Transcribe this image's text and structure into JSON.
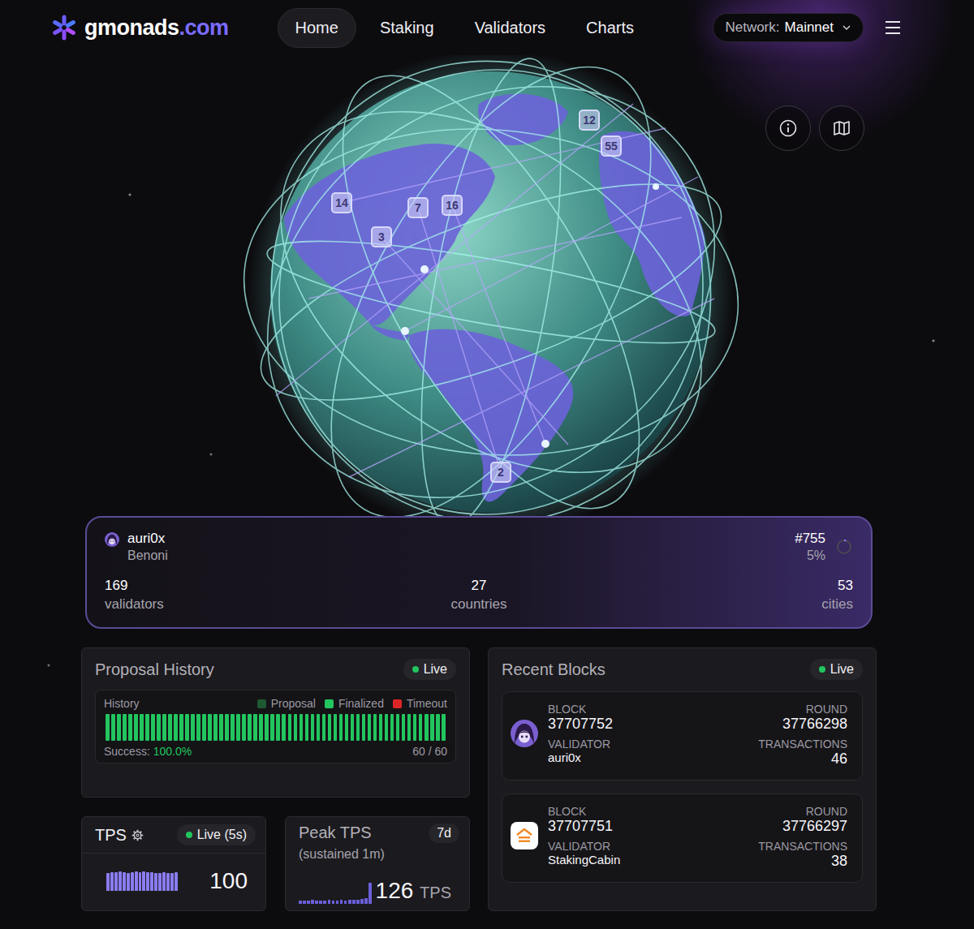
{
  "logo": {
    "name": "gmonads",
    "tld": ".com"
  },
  "nav": [
    {
      "label": "Home",
      "selected": true
    },
    {
      "label": "Staking",
      "selected": false
    },
    {
      "label": "Validators",
      "selected": false
    },
    {
      "label": "Charts",
      "selected": false
    }
  ],
  "network": {
    "label": "Network:",
    "value": "Mainnet"
  },
  "pins": [
    {
      "label": "12"
    },
    {
      "label": "55"
    },
    {
      "label": "14"
    },
    {
      "label": "7"
    },
    {
      "label": "16"
    },
    {
      "label": "3"
    },
    {
      "label": "2"
    }
  ],
  "current": {
    "validator": "auri0x",
    "city": "Benoni",
    "avatar": "anime",
    "rank": "#755",
    "progress": "5%",
    "level": 0.05
  },
  "stats": [
    {
      "value": "169",
      "label": "validators"
    },
    {
      "value": "27",
      "label": "countries"
    },
    {
      "value": "53",
      "label": "cities"
    }
  ],
  "proposal_history": {
    "title": "Proposal History",
    "live": "Live",
    "label": "History",
    "legend": [
      {
        "label": "Proposal",
        "kind": "proposal",
        "color": "#1e5a31"
      },
      {
        "label": "Finalized",
        "kind": "finalized",
        "color": "#22c55e"
      },
      {
        "label": "Timeout",
        "kind": "timeout",
        "color": "#dc2626"
      }
    ],
    "bars": [
      "finalized",
      "finalized",
      "finalized",
      "finalized",
      "finalized",
      "finalized",
      "finalized",
      "finalized",
      "finalized",
      "finalized",
      "finalized",
      "finalized",
      "finalized",
      "finalized",
      "finalized",
      "finalized",
      "finalized",
      "finalized",
      "finalized",
      "finalized",
      "finalized",
      "finalized",
      "finalized",
      "finalized",
      "finalized",
      "finalized",
      "finalized",
      "finalized",
      "finalized",
      "finalized",
      "finalized",
      "finalized",
      "finalized",
      "finalized",
      "finalized",
      "finalized",
      "finalized",
      "finalized",
      "finalized",
      "finalized",
      "finalized",
      "finalized",
      "finalized",
      "finalized",
      "finalized",
      "finalized",
      "finalized",
      "finalized",
      "finalized",
      "finalized",
      "finalized",
      "finalized",
      "finalized",
      "finalized",
      "finalized",
      "finalized",
      "finalized",
      "finalized",
      "finalized",
      "finalized"
    ],
    "success_label": "Success:",
    "success": "100.0%",
    "count": "60 / 60"
  },
  "tps": {
    "title": "TPS",
    "live": "Live (5s)",
    "values": [
      98,
      102,
      100,
      104,
      101,
      99,
      103,
      105,
      100,
      106,
      102,
      101,
      99,
      97,
      100,
      98,
      96,
      100
    ],
    "value": "100"
  },
  "peak_tps": {
    "title": "Peak TPS",
    "subtitle": "(sustained 1m)",
    "range": "7d",
    "values": [
      20,
      21,
      20,
      22,
      21,
      20,
      21,
      22,
      21,
      20,
      22,
      21,
      23,
      24,
      26,
      30,
      34,
      126
    ],
    "value": "126",
    "unit": "TPS"
  },
  "recent_blocks": {
    "title": "Recent Blocks",
    "live": "Live",
    "labels": {
      "block": "BLOCK",
      "round": "ROUND",
      "validator": "VALIDATOR",
      "transactions": "TRANSACTIONS"
    },
    "blocks": [
      {
        "block": "37707752",
        "round": "37766298",
        "validator": "auri0x",
        "transactions": "46",
        "avatar": "anime"
      },
      {
        "block": "37707751",
        "round": "37766297",
        "validator": "StakingCabin",
        "transactions": "38",
        "avatar": "cabin"
      }
    ]
  }
}
